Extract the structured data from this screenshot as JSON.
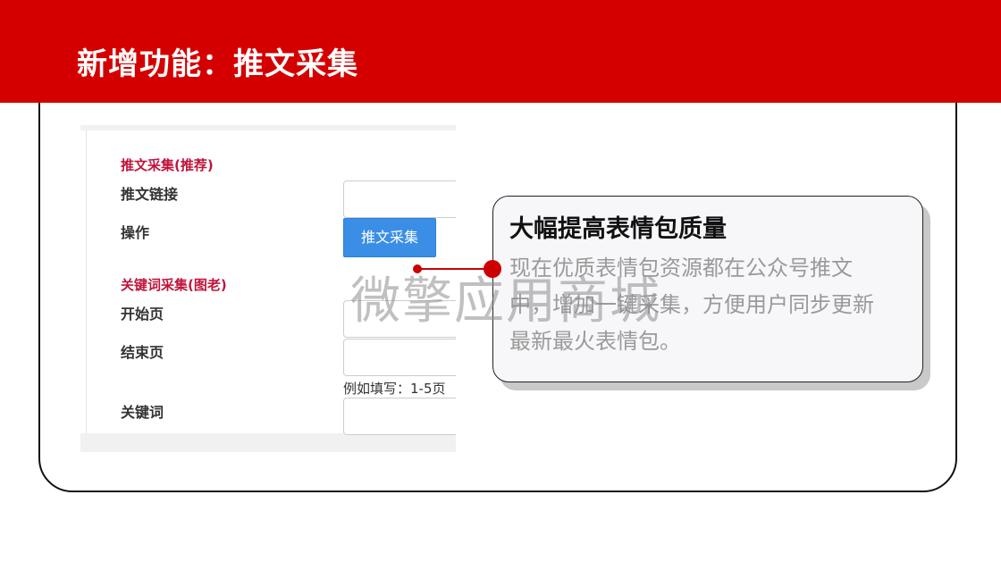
{
  "header": {
    "title": "新增功能：推文采集"
  },
  "form": {
    "section1_title": "推文采集(推荐)",
    "link_label": "推文链接",
    "action_label": "操作",
    "collect_button": "推文采集",
    "section2_title": "关键词采集(图老)",
    "start_page_label": "开始页",
    "end_page_label": "结束页",
    "page_hint": "例如填写：1-5页",
    "keyword_label": "关键词"
  },
  "callout": {
    "title": "大幅提高表情包质量",
    "body": "现在优质表情包资源都在公众号推文中，增加一键采集，方便用户同步更新最新最火表情包。"
  },
  "watermark": "微擎应用商城",
  "colors": {
    "header": "#d40000",
    "accent_red": "#cc0000",
    "section_title": "#c0143c",
    "button": "#3a8ee6"
  }
}
